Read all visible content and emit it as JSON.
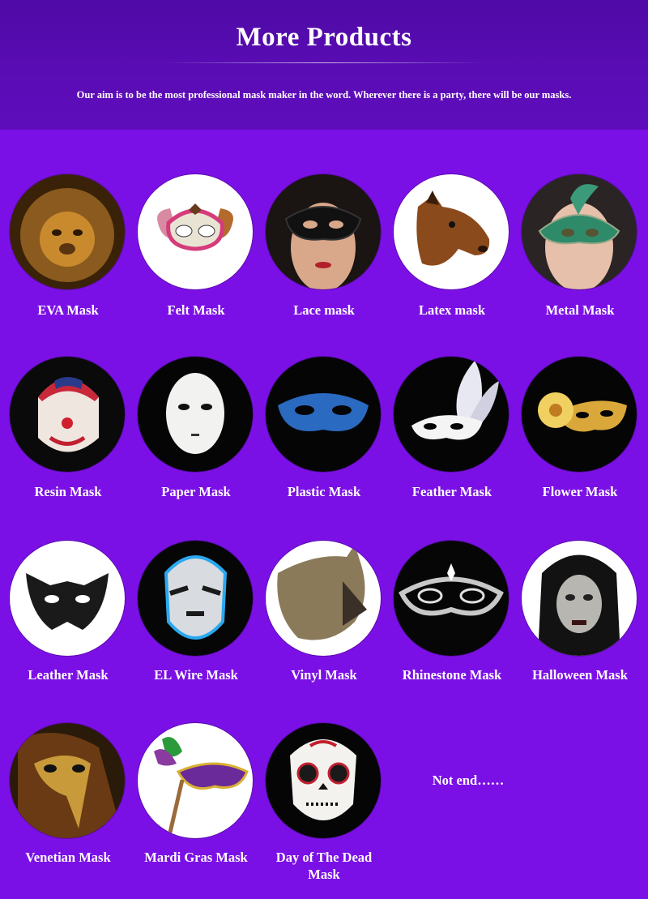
{
  "header": {
    "title": "More Products",
    "subtitle": "Our aim is to be the most professional mask maker in the word. Wherever there is a party, there will be our masks."
  },
  "products": [
    {
      "label": "EVA Mask",
      "icon": "lion-mask-icon"
    },
    {
      "label": "Felt Mask",
      "icon": "felt-puppy-mask-icon"
    },
    {
      "label": "Lace mask",
      "icon": "lace-mask-icon"
    },
    {
      "label": "Latex mask",
      "icon": "horse-head-mask-icon"
    },
    {
      "label": "Metal Mask",
      "icon": "metal-filigree-mask-icon"
    },
    {
      "label": "Resin Mask",
      "icon": "flag-clown-mask-icon"
    },
    {
      "label": "Paper Mask",
      "icon": "white-full-face-mask-icon"
    },
    {
      "label": "Plastic Mask",
      "icon": "blue-half-mask-icon"
    },
    {
      "label": "Feather Mask",
      "icon": "feather-mask-icon"
    },
    {
      "label": "Flower Mask",
      "icon": "gold-flower-mask-icon"
    },
    {
      "label": "Leather Mask",
      "icon": "black-cat-mask-icon"
    },
    {
      "label": "EL Wire Mask",
      "icon": "el-wire-mask-icon"
    },
    {
      "label": "Vinyl Mask",
      "icon": "wolf-head-mask-icon"
    },
    {
      "label": "Rhinestone Mask",
      "icon": "rhinestone-mask-icon"
    },
    {
      "label": "Halloween Mask",
      "icon": "ghost-girl-mask-icon"
    },
    {
      "label": "Venetian Mask",
      "icon": "plague-doctor-mask-icon"
    },
    {
      "label": "Mardi Gras Mask",
      "icon": "mardi-gras-stick-mask-icon"
    },
    {
      "label": "Day of The Dead Mask",
      "icon": "sugar-skull-mask-icon"
    }
  ],
  "footer_note": "Not end……",
  "colors": {
    "background": "#7b10e6",
    "header_background": "#5a0cb5",
    "text": "#ffffff"
  }
}
